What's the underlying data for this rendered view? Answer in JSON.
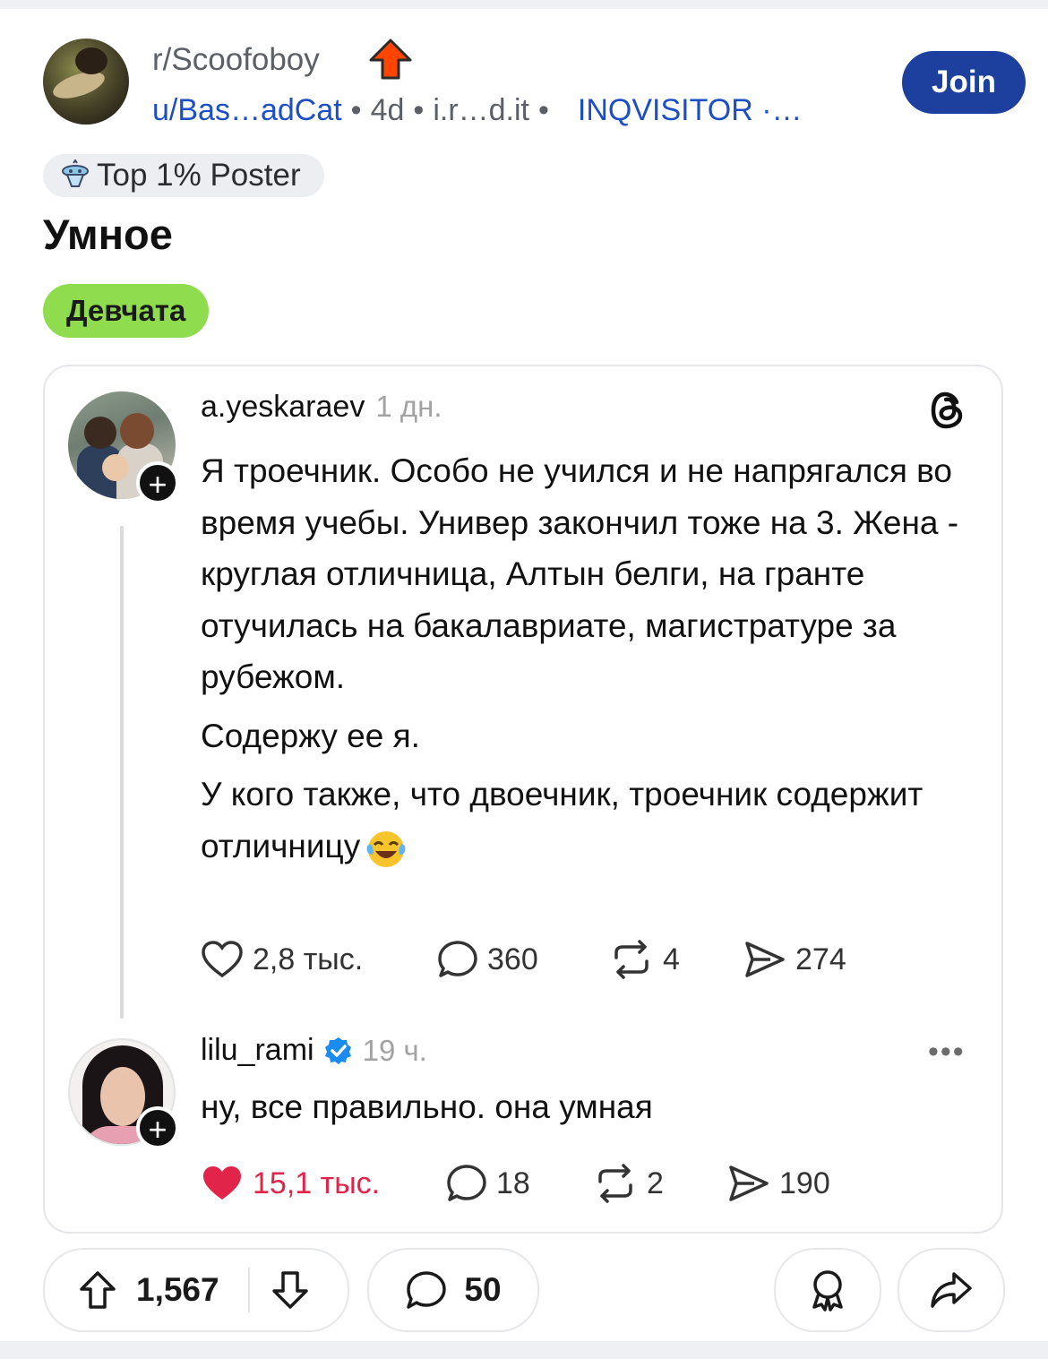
{
  "header": {
    "subreddit": "r/Scoofoboy",
    "meta_user": "u/Bas…adCat",
    "meta_age": "4d",
    "meta_domain": "i.r…d.it",
    "meta_flair_user": "INQVISITOR ·…",
    "join_label": "Join"
  },
  "badge": {
    "label": "Top 1% Poster"
  },
  "post": {
    "title": "Умное",
    "flair": "Девчата"
  },
  "embed": {
    "post1": {
      "username": "a.yeskaraev",
      "time": "1 дн.",
      "body_p1": "Я троечник. Особо не учился и не напрягался во время учебы. Универ закончил тоже на 3. Жена - круглая отличница, Алтын белги, на гранте отучилась на бакалавриате, магистратуре за рубежом.",
      "body_p2": "Содержу ее я.",
      "body_p3": "У кого также, что двоечник, троечник содержит отличницу",
      "likes": "2,8 тыс.",
      "replies": "360",
      "reposts": "4",
      "shares": "274",
      "plus": "+"
    },
    "post2": {
      "username": "lilu_rami",
      "time": "19 ч.",
      "body": "ну, все правильно. она умная",
      "likes": "15,1 тыс.",
      "replies": "18",
      "reposts": "2",
      "shares": "190",
      "plus": "+",
      "more": "•••"
    }
  },
  "actions": {
    "upvotes": "1,567",
    "comments": "50"
  },
  "colors": {
    "brand_blue": "#1d3f9e",
    "link_blue": "#1d4fc4",
    "flair_green": "#8fdc4e",
    "like_red": "#e0244a",
    "upvote_orange": "#ff4500"
  },
  "icons": [
    "upvote-arrow-icon",
    "snoo-badge-icon",
    "threads-logo-icon",
    "heart-icon",
    "reply-bubble-icon",
    "repost-icon",
    "send-icon",
    "verified-icon",
    "more-icon",
    "upvote-icon",
    "downvote-icon",
    "comment-icon",
    "award-icon",
    "share-icon"
  ]
}
